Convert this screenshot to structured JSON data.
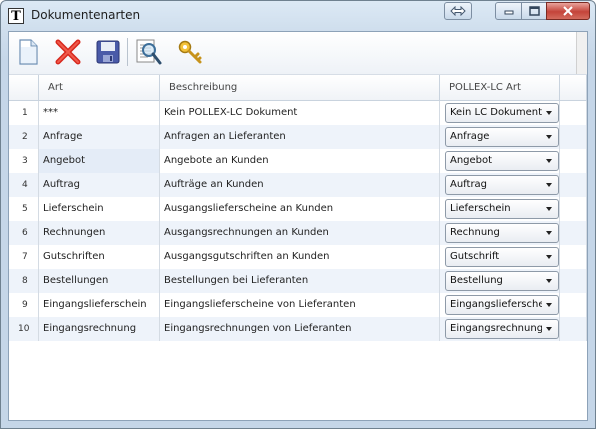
{
  "window": {
    "title": "Dokumentenarten",
    "app_icon_letter": "T"
  },
  "toolbar": {
    "buttons": [
      {
        "icon": "new-document-icon"
      },
      {
        "icon": "delete-x-icon"
      },
      {
        "icon": "save-floppy-icon"
      },
      {
        "icon": "search-magnifier-icon"
      },
      {
        "icon": "key-icon"
      }
    ]
  },
  "table": {
    "headers": {
      "art": "Art",
      "beschreibung": "Beschreibung",
      "pollex": "POLLEX-LC Art"
    },
    "rows": [
      {
        "num": "1",
        "art": "***",
        "beschreibung": "Kein POLLEX-LC Dokument",
        "pollex": "Kein LC Dokument"
      },
      {
        "num": "2",
        "art": "Anfrage",
        "beschreibung": "Anfragen an Lieferanten",
        "pollex": "Anfrage"
      },
      {
        "num": "3",
        "art": "Angebot",
        "beschreibung": "Angebote an Kunden",
        "pollex": "Angebot"
      },
      {
        "num": "4",
        "art": "Auftrag",
        "beschreibung": "Aufträge an Kunden",
        "pollex": "Auftrag"
      },
      {
        "num": "5",
        "art": "Lieferschein",
        "beschreibung": "Ausgangslieferscheine an Kunden",
        "pollex": "Lieferschein"
      },
      {
        "num": "6",
        "art": "Rechnungen",
        "beschreibung": "Ausgangsrechnungen an Kunden",
        "pollex": "Rechnung"
      },
      {
        "num": "7",
        "art": "Gutschriften",
        "beschreibung": "Ausgangsgutschriften an Kunden",
        "pollex": "Gutschrift"
      },
      {
        "num": "8",
        "art": "Bestellungen",
        "beschreibung": "Bestellungen bei Lieferanten",
        "pollex": "Bestellung"
      },
      {
        "num": "9",
        "art": "Eingangslieferschein",
        "beschreibung": "Eingangslieferscheine von Lieferanten",
        "pollex": "Eingangslieferschein"
      },
      {
        "num": "10",
        "art": "Eingangsrechnung",
        "beschreibung": "Eingangsrechnungen von Lieferanten",
        "pollex": "Eingangsrechnung"
      }
    ]
  }
}
